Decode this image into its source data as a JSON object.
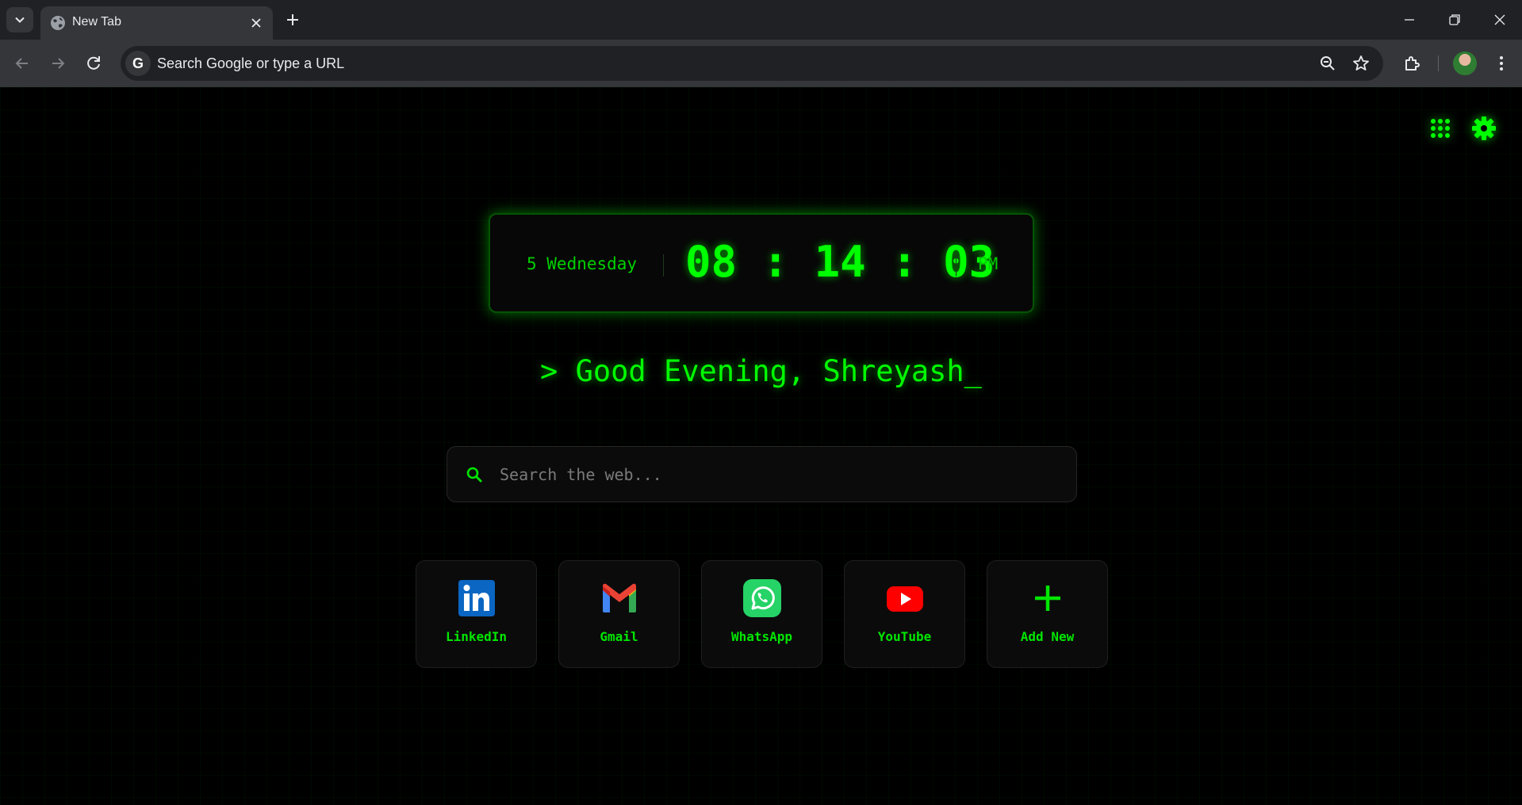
{
  "browser": {
    "tab_title": "New Tab",
    "omnibox_placeholder": "Search Google or type a URL"
  },
  "clock": {
    "date": "5 Wednesday",
    "hours": "08",
    "minutes": "14",
    "seconds": "03",
    "separator": ":",
    "ampm": "PM"
  },
  "greeting": "> Good Evening, Shreyash_",
  "search": {
    "placeholder": "Search the web..."
  },
  "shortcuts": [
    {
      "label": "LinkedIn",
      "icon": "linkedin-icon"
    },
    {
      "label": "Gmail",
      "icon": "gmail-icon"
    },
    {
      "label": "WhatsApp",
      "icon": "whatsapp-icon"
    },
    {
      "label": "YouTube",
      "icon": "youtube-icon"
    },
    {
      "label": "Add New",
      "icon": "plus-icon"
    }
  ],
  "colors": {
    "accent": "#00ff00",
    "background": "#000000",
    "chrome_dark": "#202124",
    "chrome_toolbar": "#35363a"
  }
}
